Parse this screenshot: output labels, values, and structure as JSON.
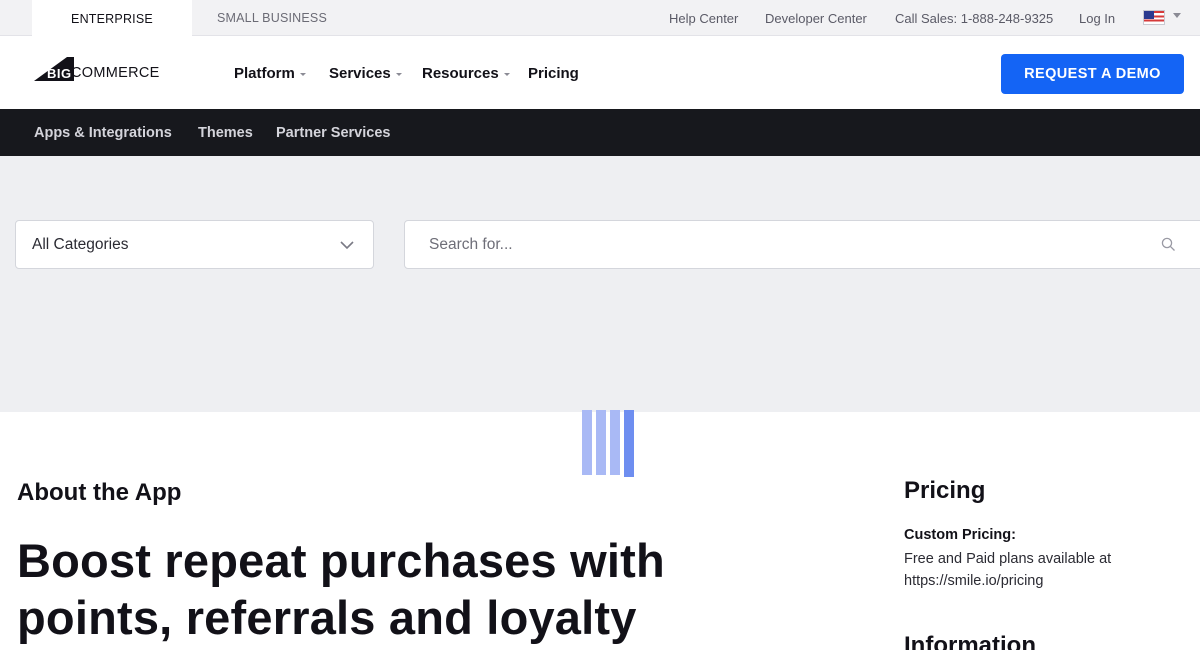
{
  "topbar": {
    "segments": [
      "ENTERPRISE",
      "SMALL BUSINESS"
    ],
    "links": [
      "Help Center",
      "Developer Center",
      "Call Sales: 1-888-248-9325",
      "Log In"
    ],
    "flag_icon": "us-flag-icon"
  },
  "header": {
    "logo": {
      "big": "BIG",
      "commerce": "COMMERCE"
    },
    "nav": [
      "Platform",
      "Services",
      "Resources",
      "Pricing"
    ],
    "cta": "REQUEST A DEMO",
    "cta_color": "#1464f5"
  },
  "subnav": {
    "items": [
      "Apps & Integrations",
      "Themes",
      "Partner Services"
    ]
  },
  "filters": {
    "category_selected": "All Categories",
    "search_placeholder": "Search for..."
  },
  "loader": {
    "bar_colors": [
      "#a9b9f5",
      "#a9b9f5",
      "#a9b9f5",
      "#6e8ef0"
    ]
  },
  "content": {
    "about_heading": "About the App",
    "headline": "Boost repeat purchases with points, referrals and loyalty"
  },
  "sidebar": {
    "pricing_heading": "Pricing",
    "pricing_label": "Custom Pricing:",
    "pricing_text": "Free and Paid plans available at https://smile.io/pricing",
    "info_heading": "Information"
  }
}
